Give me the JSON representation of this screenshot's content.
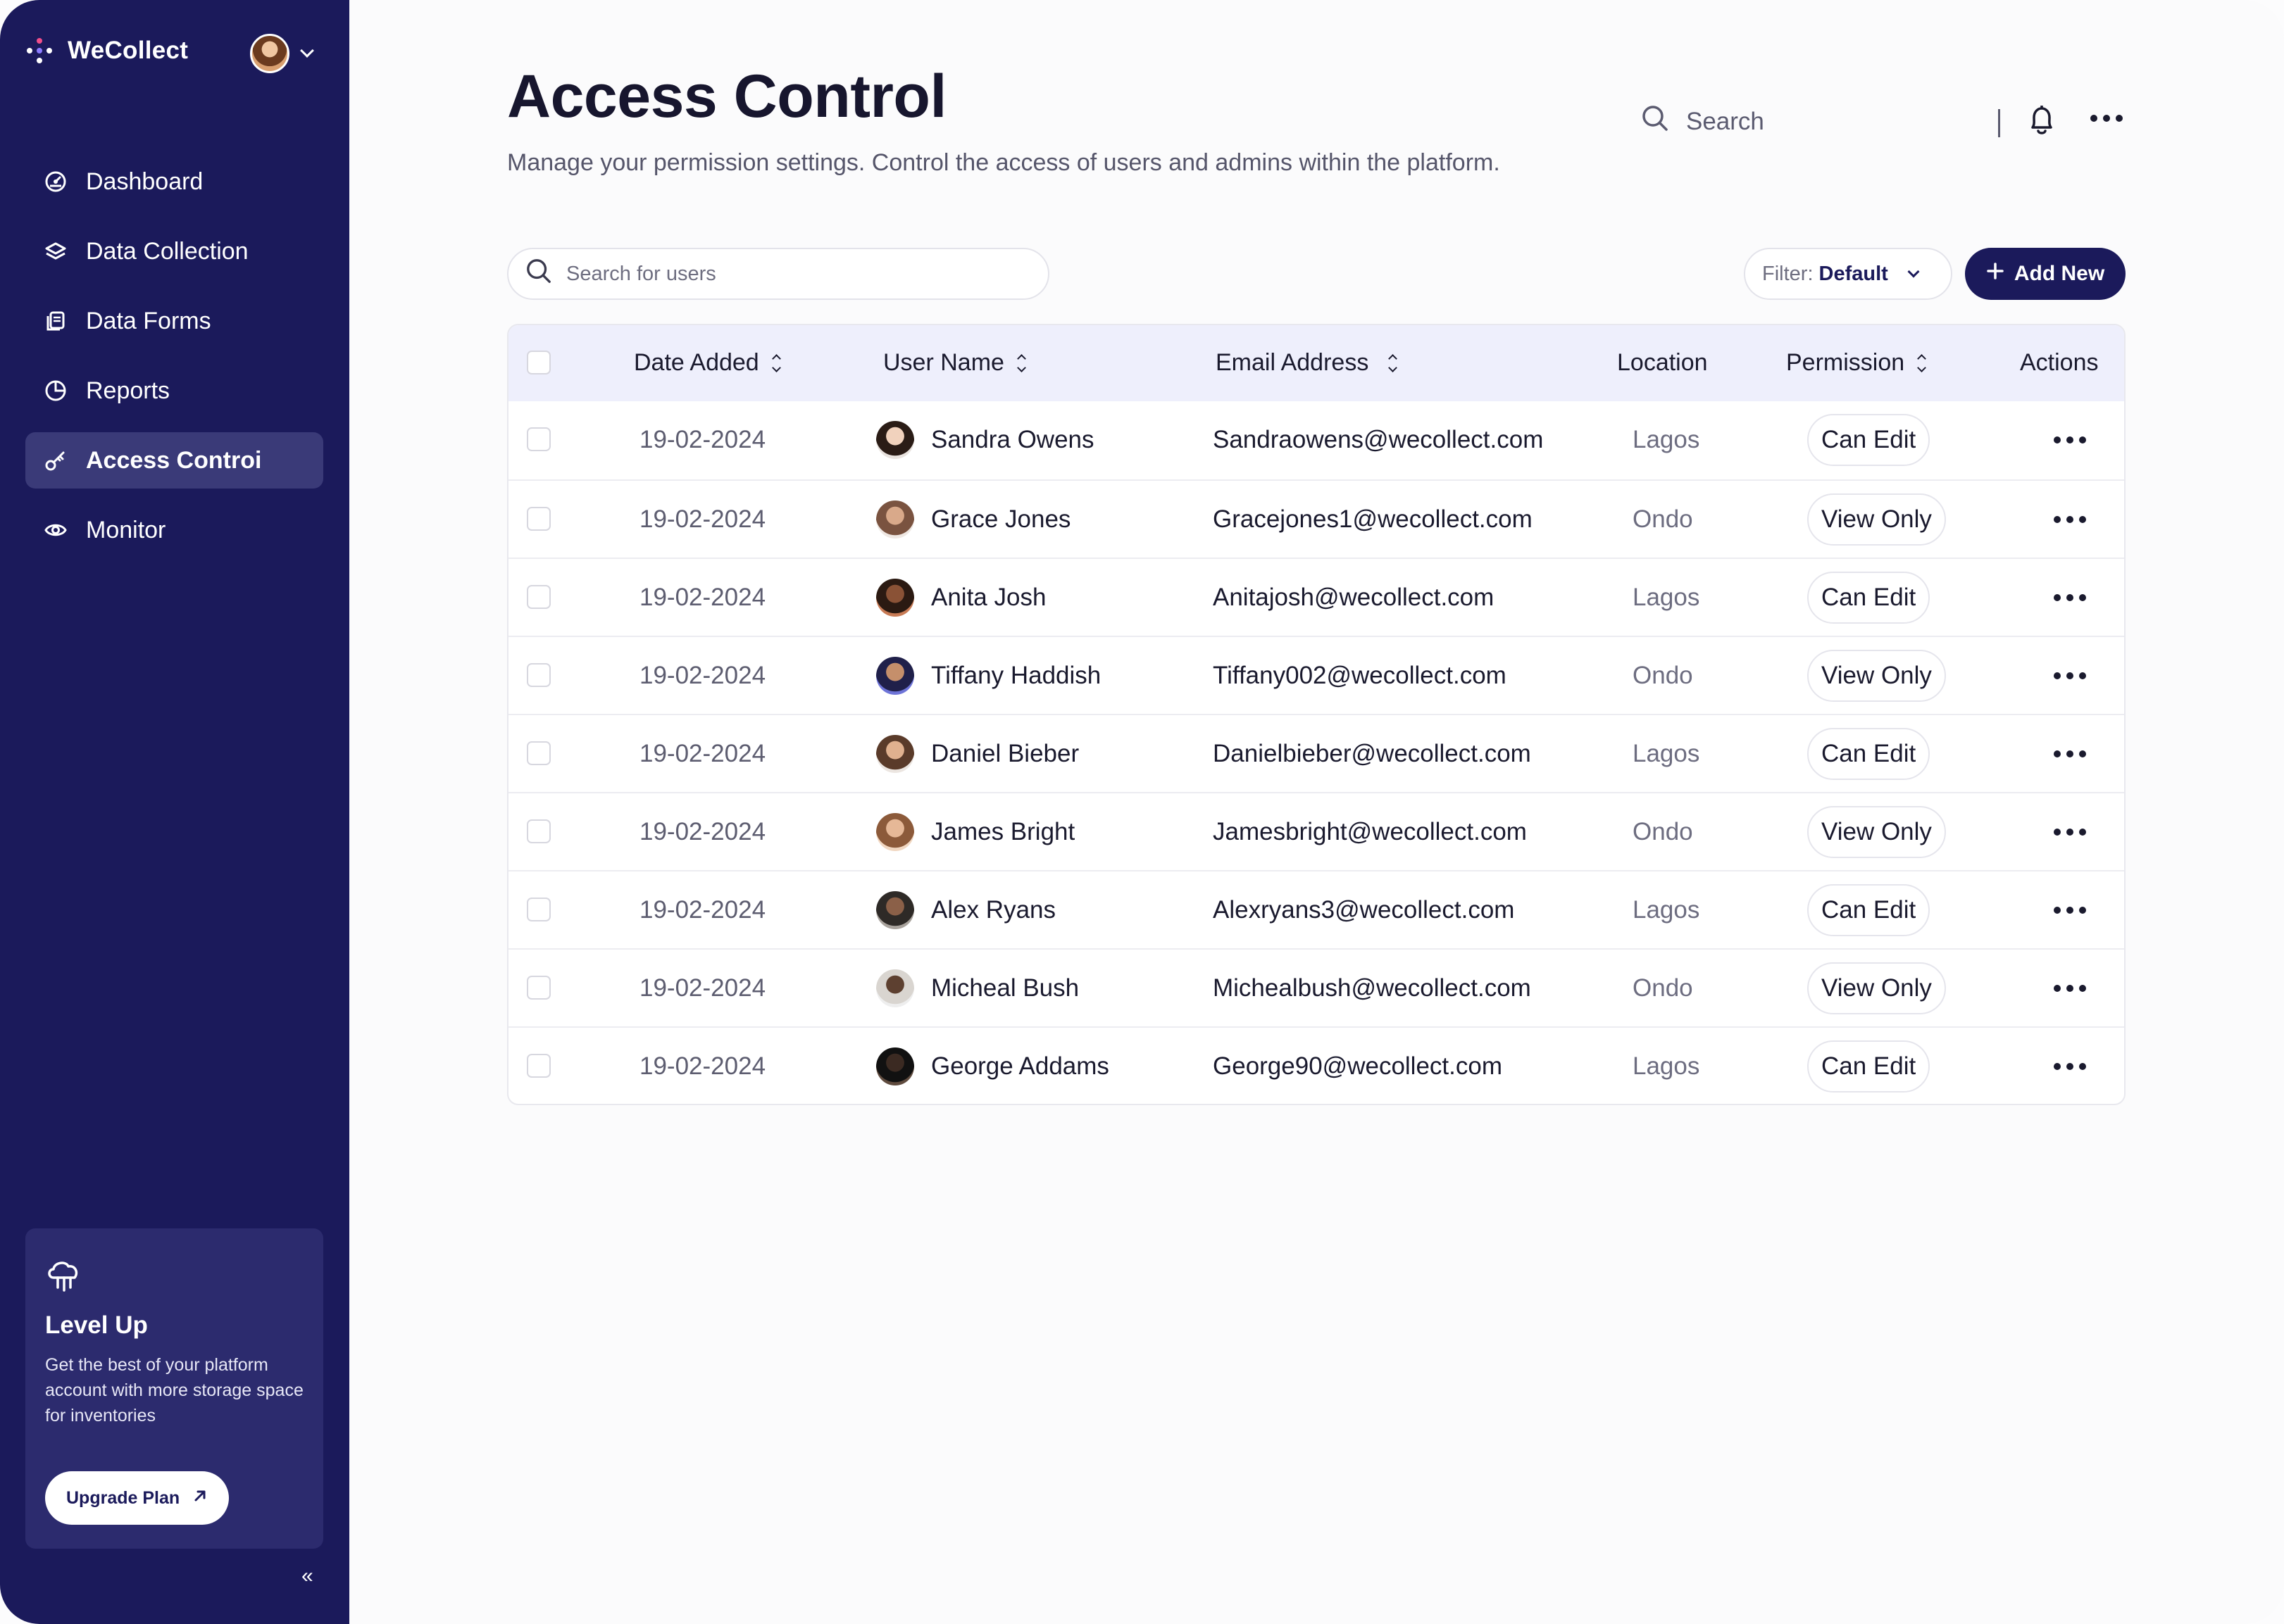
{
  "app": {
    "name": "WeCollect"
  },
  "sidebar": {
    "items": [
      {
        "label": "Dashboard",
        "icon": "dashboard-icon"
      },
      {
        "label": "Data Collection",
        "icon": "layers-icon"
      },
      {
        "label": "Data Forms",
        "icon": "forms-icon"
      },
      {
        "label": "Reports",
        "icon": "pie-chart-icon"
      },
      {
        "label": "Access Controi",
        "icon": "key-icon",
        "active": true
      },
      {
        "label": "Monitor",
        "icon": "eye-icon"
      }
    ],
    "promo": {
      "title": "Level Up",
      "text": "Get the best of your platform account with more storage space for inventories",
      "button": "Upgrade Plan"
    },
    "collapse_label": "«"
  },
  "header": {
    "title": "Access Control",
    "subtitle": "Manage your permission settings. Control the access of users and admins within the platform.",
    "search_placeholder": "Search"
  },
  "toolbar": {
    "user_search_placeholder": "Search for users",
    "filter_label": "Filter:",
    "filter_value": "Default",
    "add_label": "Add New"
  },
  "table": {
    "columns": {
      "date": "Date Added",
      "user": "User Name",
      "email": "Email Address",
      "location": "Location",
      "permission": "Permission",
      "actions": "Actions"
    },
    "rows": [
      {
        "date": "19-02-2024",
        "name": "Sandra Owens",
        "email": "Sandraowens@wecollect.com",
        "location": "Lagos",
        "permission": "Can Edit"
      },
      {
        "date": "19-02-2024",
        "name": "Grace Jones",
        "email": "Gracejones1@wecollect.com",
        "location": "Ondo",
        "permission": "View Only"
      },
      {
        "date": "19-02-2024",
        "name": "Anita Josh",
        "email": "Anitajosh@wecollect.com",
        "location": "Lagos",
        "permission": "Can Edit"
      },
      {
        "date": "19-02-2024",
        "name": "Tiffany Haddish",
        "email": "Tiffany002@wecollect.com",
        "location": "Ondo",
        "permission": "View Only"
      },
      {
        "date": "19-02-2024",
        "name": "Daniel Bieber",
        "email": "Danielbieber@wecollect.com",
        "location": "Lagos",
        "permission": "Can Edit"
      },
      {
        "date": "19-02-2024",
        "name": "James Bright",
        "email": "Jamesbright@wecollect.com",
        "location": "Ondo",
        "permission": "View Only"
      },
      {
        "date": "19-02-2024",
        "name": "Alex Ryans",
        "email": "Alexryans3@wecollect.com",
        "location": "Lagos",
        "permission": "Can Edit"
      },
      {
        "date": "19-02-2024",
        "name": "Micheal Bush",
        "email": "Michealbush@wecollect.com",
        "location": "Ondo",
        "permission": "View Only"
      },
      {
        "date": "19-02-2024",
        "name": "George Addams",
        "email": "George90@wecollect.com",
        "location": "Lagos",
        "permission": "Can Edit"
      }
    ]
  },
  "colors": {
    "sidebar": "#1b1a5b",
    "accent": "#1b1a5b",
    "table_header": "#eeeffc",
    "active_nav": "#3a3a78"
  }
}
